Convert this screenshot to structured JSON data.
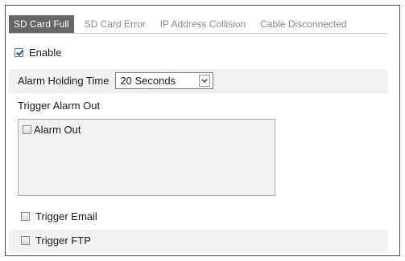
{
  "tabs": [
    {
      "label": "SD Card Full",
      "active": true
    },
    {
      "label": "SD Card Error",
      "active": false
    },
    {
      "label": "IP Address Collision",
      "active": false
    },
    {
      "label": "Cable Disconnected",
      "active": false
    }
  ],
  "enable": {
    "label": "Enable",
    "checked": true
  },
  "alarm_holding_time": {
    "label": "Alarm Holding Time",
    "value": "20 Seconds"
  },
  "trigger_alarm_out": {
    "label": "Trigger Alarm Out"
  },
  "alarm_out": {
    "label": "Alarm Out",
    "checked": false
  },
  "trigger_email": {
    "label": "Trigger Email",
    "checked": false
  },
  "trigger_ftp": {
    "label": "Trigger FTP",
    "checked": false
  },
  "icons": {
    "select_arrow": "chevron-down-icon"
  }
}
